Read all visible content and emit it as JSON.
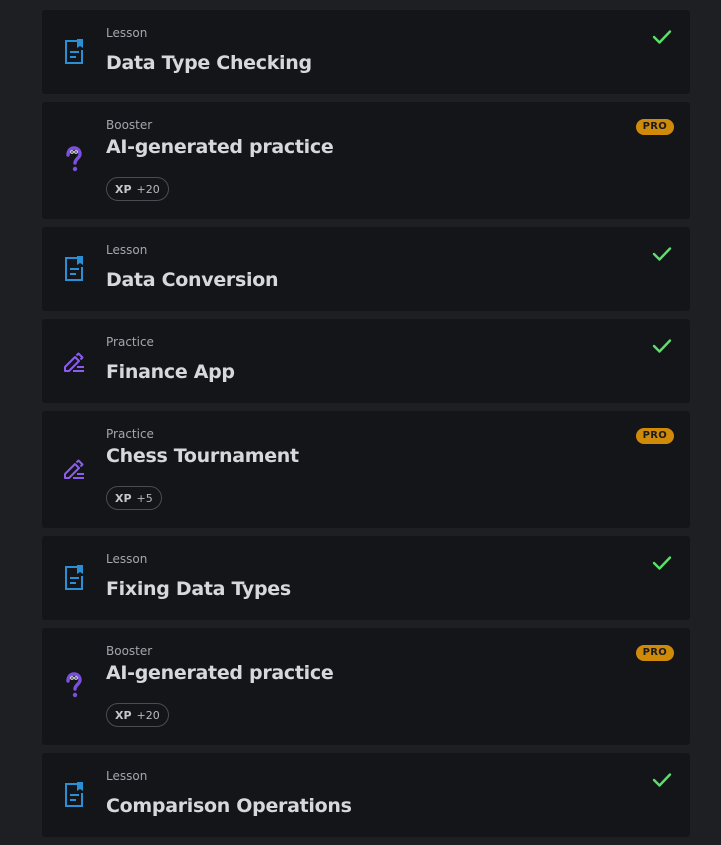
{
  "colors": {
    "lesson_icon": "#2b8fd6",
    "practice_icon": "#8a5cf0",
    "booster_icon": "#7b4fe0",
    "check": "#5be06a",
    "pro_badge": "#d08a0a"
  },
  "items": [
    {
      "kind": "Lesson",
      "title": "Data Type Checking",
      "icon": "lesson-document-icon",
      "status": "completed"
    },
    {
      "kind": "Booster",
      "title": "AI-generated practice",
      "icon": "question-mark-icon",
      "pro": "PRO",
      "xp_label": "XP",
      "xp_value": "+20"
    },
    {
      "kind": "Lesson",
      "title": "Data Conversion",
      "icon": "lesson-document-icon",
      "status": "completed"
    },
    {
      "kind": "Practice",
      "title": "Finance App",
      "icon": "pencil-icon",
      "status": "completed"
    },
    {
      "kind": "Practice",
      "title": "Chess Tournament",
      "icon": "pencil-icon",
      "pro": "PRO",
      "xp_label": "XP",
      "xp_value": "+5"
    },
    {
      "kind": "Lesson",
      "title": "Fixing Data Types",
      "icon": "lesson-document-icon",
      "status": "completed"
    },
    {
      "kind": "Booster",
      "title": "AI-generated practice",
      "icon": "question-mark-icon",
      "pro": "PRO",
      "xp_label": "XP",
      "xp_value": "+20"
    },
    {
      "kind": "Lesson",
      "title": "Comparison Operations",
      "icon": "lesson-document-icon",
      "status": "completed"
    }
  ]
}
